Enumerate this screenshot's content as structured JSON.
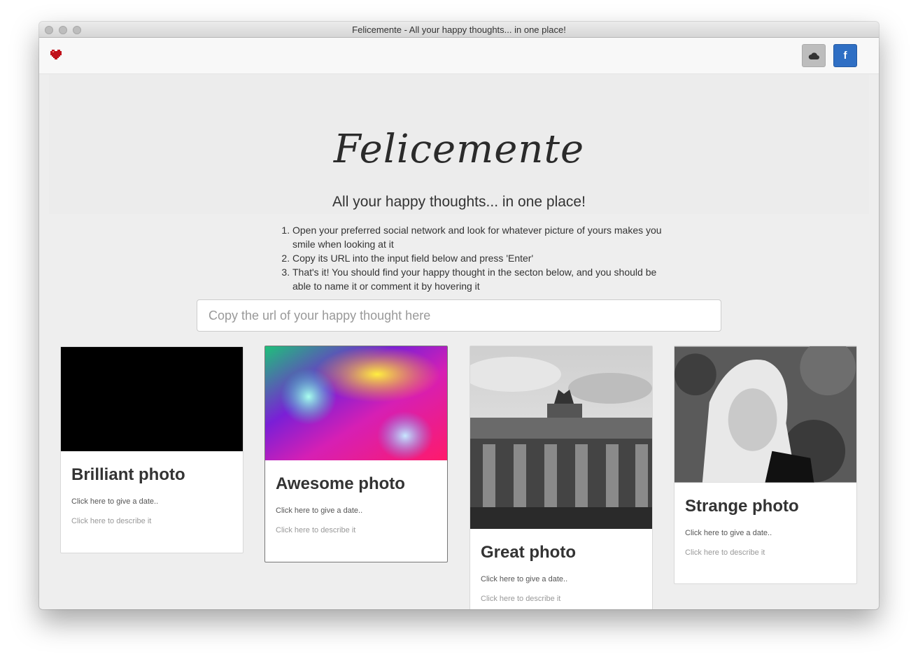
{
  "window": {
    "title": "Felicemente - All your happy thoughts... in one place!"
  },
  "navbar": {
    "brand_icon": "heart-icon",
    "cloud_icon": "cloud-icon",
    "facebook_label": "f",
    "colors": {
      "heart": "#c0101a",
      "facebook": "#2f6fc4",
      "cloud_btn": "#bdbdbd"
    }
  },
  "hero": {
    "logo": "Felicemente",
    "tagline": "All your happy thoughts... in one place!",
    "steps": [
      "Open your preferred social network and look for whatever picture of yours makes you smile when looking at it",
      "Copy its URL into the input field below and press 'Enter'",
      "That's it! You should find your happy thought in the secton below, and you should be able to name it or comment it by hovering it"
    ]
  },
  "search": {
    "placeholder": "Copy the url of your happy thought here",
    "value": ""
  },
  "cards": [
    {
      "title": "Brilliant photo",
      "date_prompt": "Click here to give a date..",
      "desc_prompt": "Click here to describe it",
      "image": "black-photo"
    },
    {
      "title": "Awesome photo",
      "date_prompt": "Click here to give a date..",
      "desc_prompt": "Click here to describe it",
      "image": "colorful-bokeh-photo"
    },
    {
      "title": "Great photo",
      "date_prompt": "Click here to give a date..",
      "desc_prompt": "Click here to describe it",
      "image": "brandenburg-gate-photo"
    },
    {
      "title": "Strange photo",
      "date_prompt": "Click here to give a date..",
      "desc_prompt": "Click here to describe it",
      "image": "portrait-photo"
    }
  ],
  "card_actions": {
    "refresh_icon": "refresh-icon",
    "delete_icon": "close-icon"
  }
}
